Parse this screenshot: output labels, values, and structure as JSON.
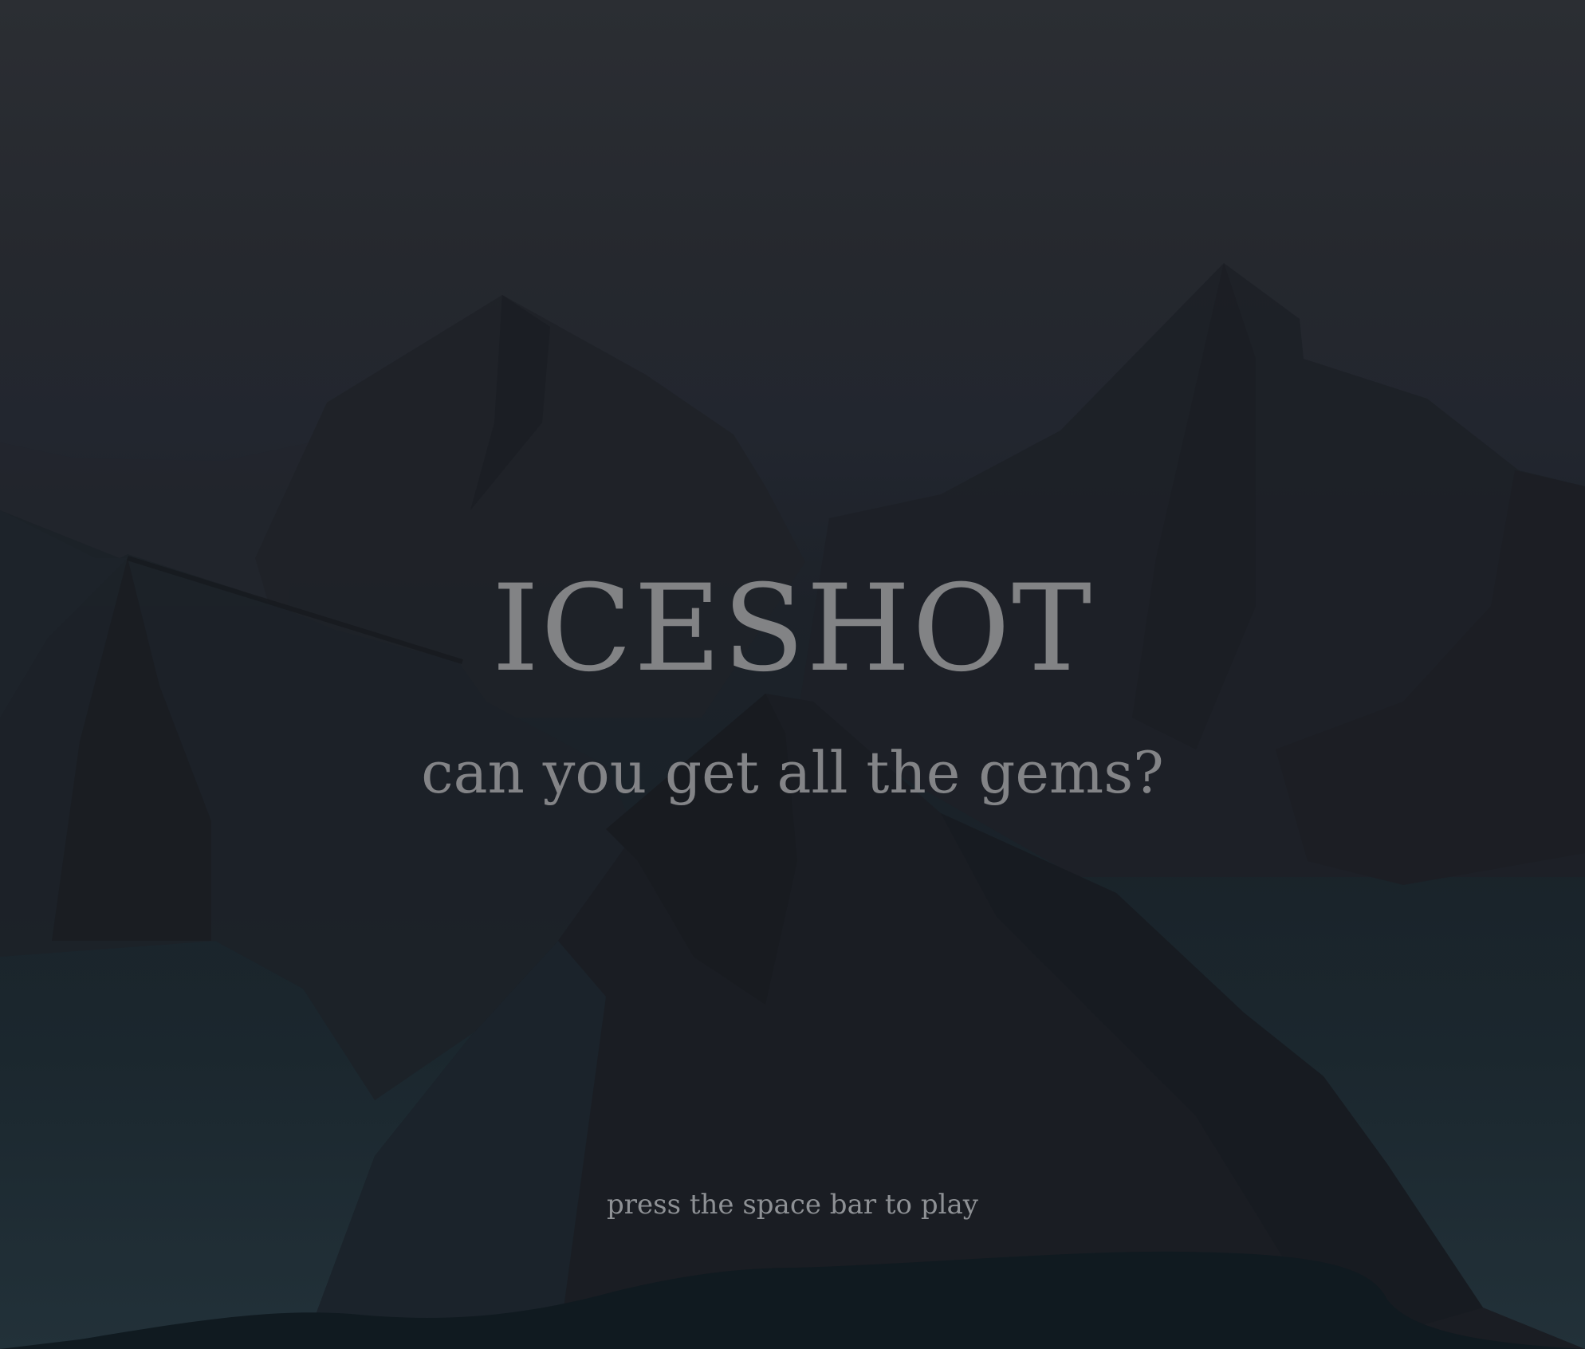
{
  "game": {
    "title": "ICESHOT",
    "tagline": "can you get all the gems?",
    "prompt": "press the space bar to play"
  },
  "colors": {
    "text": "#828385",
    "prompt_text": "#8e9195",
    "sky_top": "#2b2e33",
    "sky_bottom": "#223139",
    "mountain_dark": "#1b1d22",
    "ice_floor": "#101a20"
  }
}
